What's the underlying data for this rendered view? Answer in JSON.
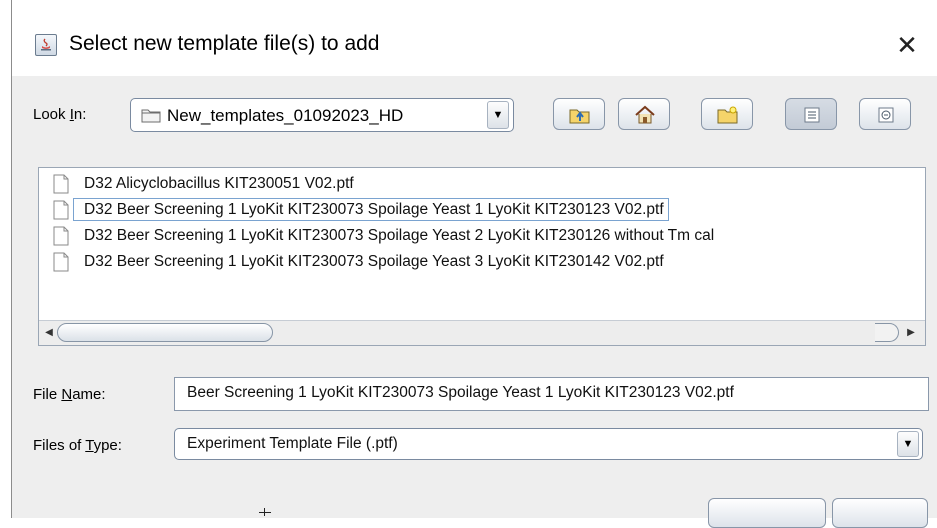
{
  "window": {
    "title": "Select new template file(s) to add",
    "close_glyph": "✕"
  },
  "look_in": {
    "label_prefix": "Look ",
    "label_mnemonic": "I",
    "label_suffix": "n:",
    "value": "New_templates_01092023_HD",
    "arrow": "▼"
  },
  "toolbar": [
    {
      "name": "up-one-level-button",
      "icon": "folder-up-icon"
    },
    {
      "name": "home-button",
      "icon": "home-icon"
    },
    {
      "name": "new-folder-button",
      "icon": "new-folder-icon"
    },
    {
      "name": "list-view-button",
      "icon": "list-view-icon"
    },
    {
      "name": "details-view-button",
      "icon": "details-view-icon"
    }
  ],
  "files": [
    {
      "name": "D32 Alicyclobacillus KIT230051 V02.ptf",
      "selected": false
    },
    {
      "name": "D32 Beer Screening 1 LyoKit KIT230073 Spoilage Yeast 1 LyoKit KIT230123 V02.ptf",
      "selected": true
    },
    {
      "name": "D32 Beer Screening 1 LyoKit KIT230073 Spoilage Yeast 2 LyoKit KIT230126 without Tm cal",
      "selected": false
    },
    {
      "name": "D32 Beer Screening 1 LyoKit KIT230073 Spoilage Yeast 3 LyoKit KIT230142 V02.ptf",
      "selected": false
    }
  ],
  "scrollbar": {
    "left_arrow": "◀",
    "right_arrow": "▶"
  },
  "file_name": {
    "label_prefix": "File ",
    "label_mnemonic": "N",
    "label_suffix": "ame:",
    "value": "Beer Screening 1 LyoKit KIT230073 Spoilage Yeast 1 LyoKit KIT230123 V02.ptf"
  },
  "file_type": {
    "label_prefix": "Files of ",
    "label_mnemonic": "T",
    "label_suffix": "ype:",
    "value": "Experiment Template File (.ptf)",
    "arrow": "▼"
  },
  "colors": {
    "dialog_background": "#eeeeee",
    "selection_border": "#7aa3d0"
  }
}
